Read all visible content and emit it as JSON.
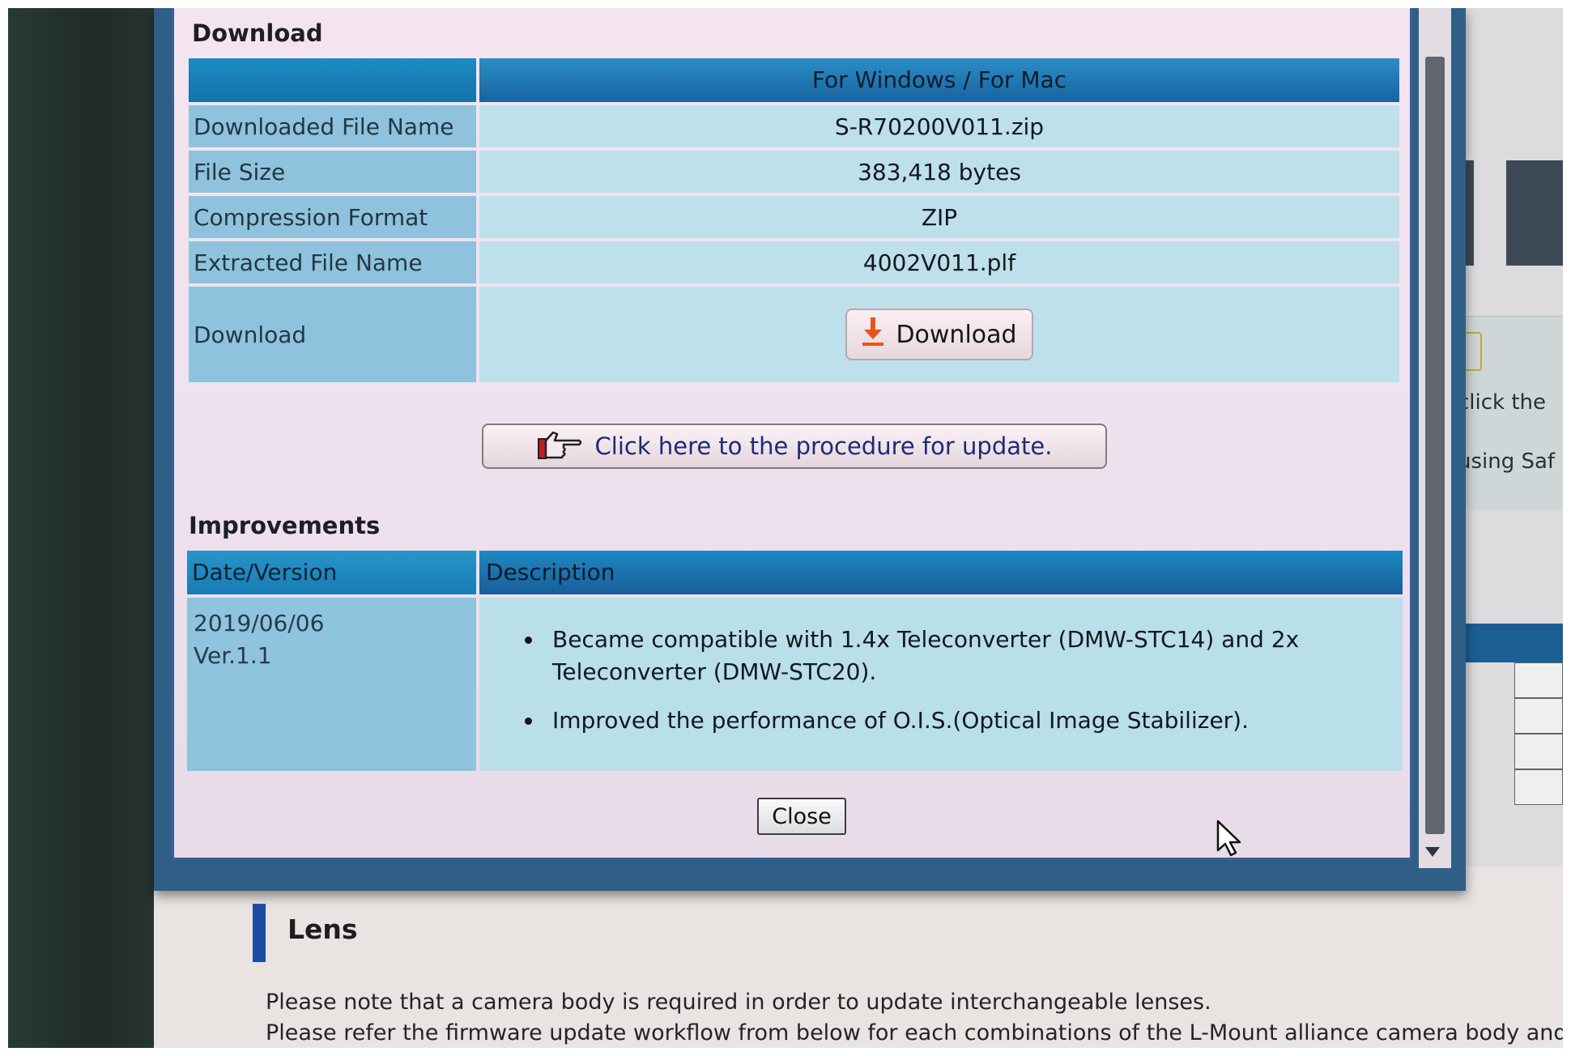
{
  "download": {
    "section_title": "Download",
    "column_header": "For Windows / For Mac",
    "rows": [
      {
        "label": "Downloaded File Name",
        "value": "S-R70200V011.zip"
      },
      {
        "label": "File Size",
        "value": "383,418 bytes"
      },
      {
        "label": "Compression Format",
        "value": "ZIP"
      },
      {
        "label": "Extracted File Name",
        "value": "4002V011.plf"
      }
    ],
    "download_row_label": "Download",
    "download_button_label": "Download",
    "procedure_button_label": "Click here to the procedure for update."
  },
  "improvements": {
    "section_title": "Improvements",
    "header_date": "Date/Version",
    "header_description": "Description",
    "date": "2019/06/06",
    "version": "Ver.1.1",
    "items": [
      "Became compatible with 1.4x Teleconverter (DMW-STC14) and 2x Teleconverter (DMW-STC20).",
      "Improved the performance of O.I.S.(Optical Image Stabilizer)."
    ]
  },
  "dialog": {
    "close_label": "Close"
  },
  "lens": {
    "title": "Lens",
    "line1": "Please note that a camera body is required in order to update interchangeable lenses.",
    "line2": "Please refer the firmware update workflow from below for each combinations of the L-Mount alliance camera body and lens."
  },
  "background": {
    "fragment1": "click the",
    "fragment2": "using Saf"
  },
  "colors": {
    "header_blue": "#1764a0",
    "label_cell": "#8fc3dd",
    "value_cell": "#bde0ea",
    "download_icon": "#e5541b",
    "lens_accent": "#1d4ca3"
  },
  "icons": {
    "download_button_icon": "download-arrow-icon",
    "procedure_button_icon": "pointing-hand-icon",
    "pointer": "mouse-cursor-icon"
  }
}
